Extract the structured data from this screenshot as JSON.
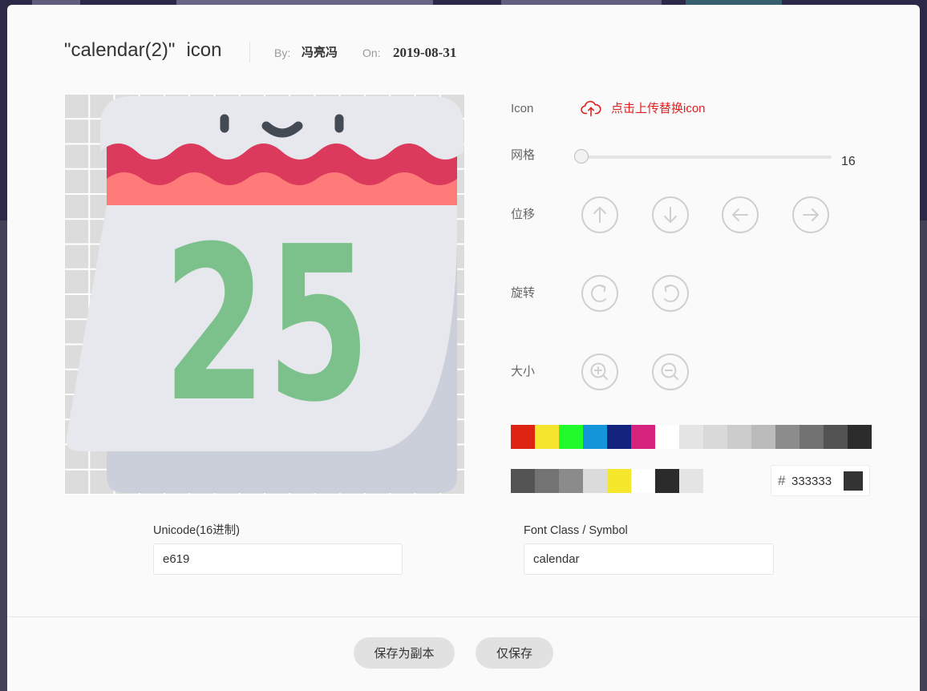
{
  "header": {
    "title_name": "\"calendar(2)\"",
    "title_suffix": "icon",
    "by_label": "By:",
    "author": "冯亮冯",
    "on_label": "On:",
    "date": "2019-08-31"
  },
  "canvas": {
    "icon": {
      "number": "25",
      "colors": {
        "cloud": "#e6e8ee",
        "wave": "#db3a5c",
        "band": "#ff7b79",
        "page": "#e6e8ee",
        "page_shadow": "#cbcfd9",
        "face": "#434a54",
        "number": "#7cc18b"
      }
    }
  },
  "controls": {
    "icon_label": "Icon",
    "upload_icon": "cloud-upload-icon",
    "upload_text": "点击上传替换icon",
    "grid_label": "网格",
    "grid_value": "16",
    "grid_level": 0,
    "move_label": "位移",
    "move_buttons": [
      "arrow-up-icon",
      "arrow-down-icon",
      "arrow-left-icon",
      "arrow-right-icon"
    ],
    "rotate_label": "旋转",
    "rotate_buttons": [
      "rotate-right-icon",
      "rotate-left-icon"
    ],
    "size_label": "大小",
    "size_buttons": [
      "zoom-in-icon",
      "zoom-out-icon"
    ]
  },
  "palette": {
    "preset": [
      "#dd2311",
      "#f5e52f",
      "#22fb2b",
      "#1696da",
      "#14237e",
      "#d7237d",
      "#ffffff",
      "#e5e5e5",
      "#d9d9d9",
      "#cccccc",
      "#bbbbbb",
      "#8c8c8c",
      "#727272",
      "#525252",
      "#2c2c2c"
    ],
    "recent": [
      "#545454",
      "#737373",
      "#8b8b8b",
      "#dbdbdb",
      "#f5e82c",
      "#ffffff",
      "#2b2b2b",
      "#e5e5e5"
    ]
  },
  "color_input": {
    "prefix": "#",
    "value": "333333",
    "preview": "#333333"
  },
  "fields": {
    "unicode_label": "Unicode(16进制)",
    "unicode_value": "e619",
    "font_class_label": "Font Class / Symbol",
    "font_class_value": "calendar"
  },
  "footer": {
    "save_copy": "保存为副本",
    "save_only": "仅保存"
  },
  "theme": {
    "accent": "#e02020",
    "modal_bg": "#fafafa",
    "button_bg": "#e1e1e1",
    "control_stroke": "#cfcfcf"
  }
}
